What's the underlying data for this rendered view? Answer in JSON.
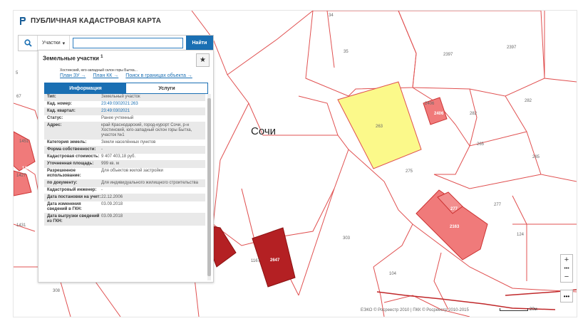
{
  "app": {
    "title": "ПУБЛИЧНАЯ КАДАСТРОВАЯ КАРТА"
  },
  "search": {
    "type_label": "Участки",
    "value": "",
    "placeholder": "",
    "find_label": "Найти"
  },
  "panel": {
    "heading": "Земельные участки",
    "heading_count": "1",
    "address_line": "Хостинский, юго-западный склон горы Бытха...",
    "links": [
      "План ЗУ →",
      "План КК →",
      "Поиск в границах объекта →"
    ],
    "tabs": [
      "Информация",
      "Услуги"
    ],
    "rows": [
      {
        "k": "Тип:",
        "v": "Земельный участок"
      },
      {
        "k": "Кад. номер:",
        "v": "23:49:0302021:263"
      },
      {
        "k": "Кад. квартал:",
        "v": "23:49:0302021"
      },
      {
        "k": "Статус:",
        "v": "Ранее учтенный"
      },
      {
        "k": "Адрес:",
        "v": "край Краснодарский, город-курорт Сочи, р-н Хостинский, юго-западный склон горы Бытха, участок №1"
      },
      {
        "k": "Категория земель:",
        "v": "Земли населённых пунктов"
      },
      {
        "k": "Форма собственности:",
        "v": "-"
      },
      {
        "k": "Кадастровая стоимость:",
        "v": "9 407 403,18 руб."
      },
      {
        "k": "Уточненная площадь:",
        "v": "999 кв. м"
      },
      {
        "k": "Разрешенное использование:",
        "v": "Для объектов жилой застройки"
      },
      {
        "k": "по документу:",
        "v": "Для индивидуального жилищного строительства"
      },
      {
        "k": "Кадастровый инженер:",
        "v": "-"
      },
      {
        "k": "Дата постановки на учет:",
        "v": "22.12.2006"
      },
      {
        "k": "Дата изменения сведений в ГКН:",
        "v": "03.09.2018"
      },
      {
        "k": "Дата выгрузки сведений из ГКН:",
        "v": "03.09.2018"
      }
    ]
  },
  "map": {
    "city": "Сочи",
    "labels": [
      "34",
      "35",
      "2397",
      "2397",
      "263",
      "2406",
      "2406",
      "282",
      "282",
      "265",
      "285",
      "275",
      "277",
      "277",
      "2163",
      "124",
      "303",
      "1167",
      "2647",
      "104",
      "308",
      "1431",
      "67",
      "5",
      "1427",
      "1436",
      "1451"
    ],
    "copyright": "ЕЭКО © Росреестр 2010 | ПКК © Росреестр 2010-2015",
    "scale": "20м"
  },
  "colors": {
    "accent": "#1a6fb3",
    "selected": "#fbf98a",
    "parcel_red": "#f07a7a",
    "parcel_dark": "#c0282a",
    "boundary": "#e05050"
  }
}
